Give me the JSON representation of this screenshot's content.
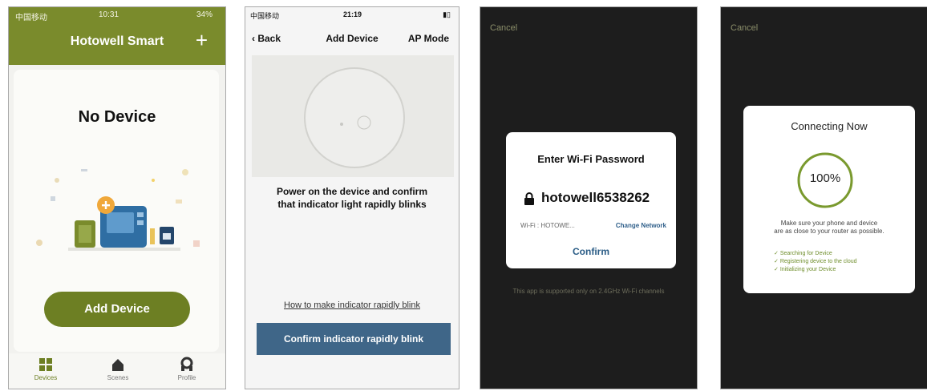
{
  "screen1": {
    "status": {
      "carrier": "中国移动",
      "time": "10:31",
      "battery": "34%"
    },
    "title": "Hotowell Smart",
    "add_icon": "plus-icon",
    "empty_text": "No Device",
    "add_button": "Add Device",
    "tabs": [
      {
        "label": "Devices",
        "icon": "grid-icon"
      },
      {
        "label": "Scenes",
        "icon": "home-icon"
      },
      {
        "label": "Profile",
        "icon": "person-icon"
      }
    ],
    "accent": "#7a8b2c"
  },
  "screen2": {
    "status": {
      "carrier": "中国移动",
      "time": "21:19"
    },
    "back": "Back",
    "title": "Add Device",
    "right_action": "AP Mode",
    "instruction_line1": "Power on the device and confirm",
    "instruction_line2": "that indicator light rapidly blinks",
    "help_link": "How to make indicator rapidly blink",
    "confirm_button": "Confirm indicator rapidly blink",
    "button_color": "#3f6688"
  },
  "screen3": {
    "cancel": "Cancel",
    "dialog_title": "Enter Wi-Fi Password",
    "password": "hotowell6538262",
    "wifi_label": "Wi-Fi : HOTOWE...",
    "change_network": "Change Network",
    "confirm": "Confirm",
    "note": "This app is supported only on 2.4GHz Wi-Fi channels"
  },
  "screen4": {
    "cancel": "Cancel",
    "dialog_title": "Connecting Now",
    "progress": "100%",
    "progress_value": 1.0,
    "hint_line1": "Make sure your phone and device",
    "hint_line2": "are as close to your router as possible.",
    "steps": [
      "Searching for Device",
      "Registering device to the cloud",
      "Initializing your Device"
    ],
    "ring_color": "#7a9a2e"
  }
}
